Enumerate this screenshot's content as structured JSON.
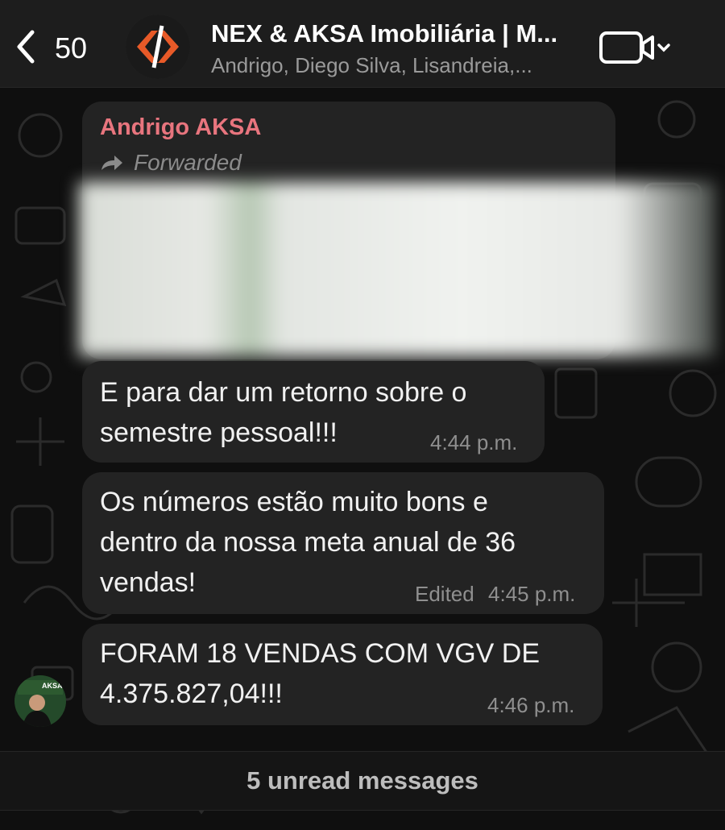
{
  "header": {
    "back_count": "50",
    "title": "NEX & AKSA Imobiliária | M...",
    "subtitle": "Andrigo, Diego Silva, Lisandreia,..."
  },
  "messages": [
    {
      "sender": "Andrigo AKSA",
      "forwarded_label": "Forwarded"
    },
    {
      "text_line1": "E para dar um retorno sobre o",
      "text_line2": "semestre pessoal!!!",
      "time": "4:44 p.m."
    },
    {
      "text_line1": "Os números estão muito bons e",
      "text_line2": "dentro da nossa meta anual de 36",
      "text_line3": "vendas!",
      "edited_label": "Edited",
      "time": "4:45 p.m."
    },
    {
      "text_line1": "FORAM 18 VENDAS COM VGV DE",
      "text_line2": "4.375.827,04!!!",
      "time": "4:46 p.m."
    }
  ],
  "avatar_badge": "AKSA",
  "unread_banner": "5 unread messages",
  "colors": {
    "sender_name": "#e8757e",
    "bubble": "#232323",
    "header": "#1d1d1d"
  }
}
